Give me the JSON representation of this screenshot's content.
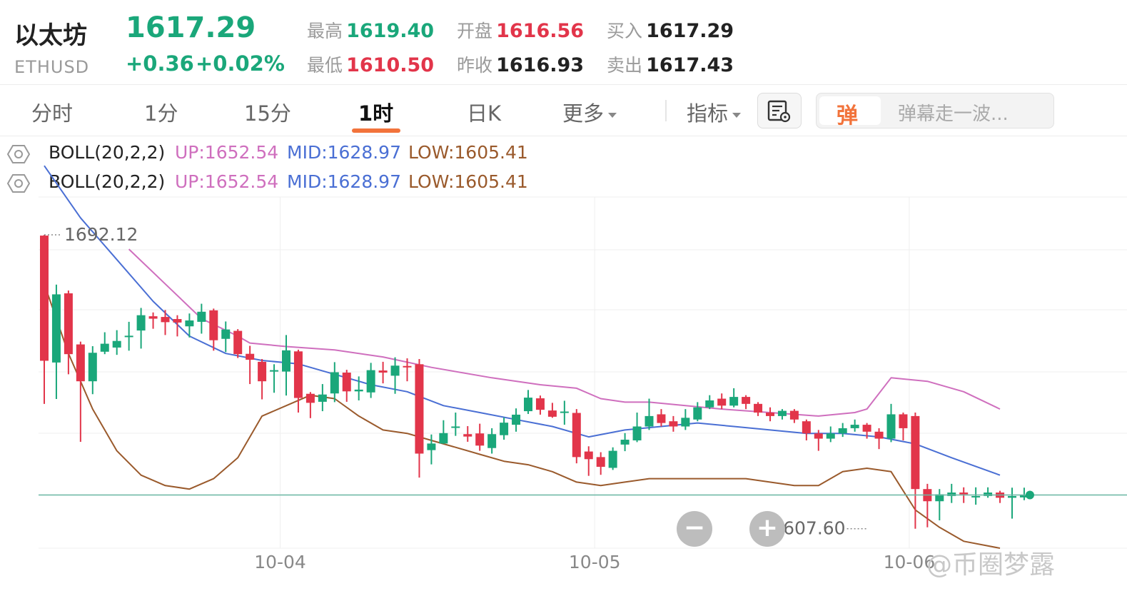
{
  "header": {
    "coin_name": "以太坊",
    "coin_code": "ETHUSD",
    "price": "1617.29",
    "change_abs": "+0.36",
    "change_pct": "+0.02%",
    "stats": [
      {
        "label": "最高",
        "value": "1619.40",
        "color": "green"
      },
      {
        "label": "最低",
        "value": "1610.50",
        "color": "red"
      },
      {
        "label": "开盘",
        "value": "1616.56",
        "color": "red"
      },
      {
        "label": "昨收",
        "value": "1616.93",
        "color": "dark"
      },
      {
        "label": "买入",
        "value": "1617.29",
        "color": "dark"
      },
      {
        "label": "卖出",
        "value": "1617.43",
        "color": "dark"
      }
    ]
  },
  "tabs": [
    {
      "label": "分时"
    },
    {
      "label": "1分"
    },
    {
      "label": "15分"
    },
    {
      "label": "1时",
      "active": true
    },
    {
      "label": "日K"
    },
    {
      "label": "更多"
    },
    {
      "label": "指标"
    }
  ],
  "danmu": {
    "icon_text": "弹",
    "placeholder": "弹幕走一波..."
  },
  "indicator_rows": [
    {
      "name": "BOLL(20,2,2)",
      "up": "UP:1652.54",
      "mid": "MID:1628.97",
      "low": "LOW:1605.41"
    },
    {
      "name": "BOLL(20,2,2)",
      "up": "UP:1652.54",
      "mid": "MID:1628.97",
      "low": "LOW:1605.41"
    }
  ],
  "zoom": {
    "minus": "−",
    "plus": "+"
  },
  "watermark": "@币圈梦露",
  "colors": {
    "up": "#1aa77a",
    "down": "#e2354a",
    "boll_up": "#cf6fbe",
    "boll_mid": "#4a6fd4",
    "boll_low": "#9a5a2c",
    "accent": "#f2733b",
    "last_price": "#6ab7a5"
  },
  "chart_data": {
    "type": "candlestick",
    "x_tick_labels": [
      {
        "label": "10-04",
        "index": 19.5
      },
      {
        "label": "10-05",
        "index": 45.5
      },
      {
        "label": "10-06",
        "index": 71.5
      }
    ],
    "ylim": [
      1602,
      1703
    ],
    "max_marker": {
      "value": "1692.12",
      "index": 0
    },
    "min_marker": {
      "value": "1607.60",
      "index": 68
    },
    "last_price": 1617.29,
    "candles": [
      [
        1691.9,
        1655.9,
        1692.1,
        1643.5
      ],
      [
        1655.4,
        1675.0,
        1677.8,
        1644.9
      ],
      [
        1675.3,
        1657.8,
        1676.1,
        1652.0
      ],
      [
        1660.6,
        1650.0,
        1661.4,
        1632.6
      ],
      [
        1650.0,
        1658.2,
        1660.1,
        1646.3
      ],
      [
        1658.5,
        1660.8,
        1664.1,
        1657.8
      ],
      [
        1659.7,
        1661.6,
        1664.7,
        1657.6
      ],
      [
        1662.9,
        1663.1,
        1667.1,
        1658.8
      ],
      [
        1664.6,
        1669.0,
        1671.1,
        1659.4
      ],
      [
        1668.7,
        1668.0,
        1669.8,
        1665.1
      ],
      [
        1668.5,
        1667.0,
        1670.5,
        1663.3
      ],
      [
        1667.9,
        1666.9,
        1669.0,
        1662.9
      ],
      [
        1665.8,
        1667.5,
        1669.5,
        1662.6
      ],
      [
        1667.1,
        1670.0,
        1672.3,
        1663.7
      ],
      [
        1670.4,
        1661.8,
        1670.9,
        1658.8
      ],
      [
        1662.2,
        1664.9,
        1667.2,
        1658.4
      ],
      [
        1664.5,
        1657.8,
        1665.0,
        1656.7
      ],
      [
        1657.9,
        1656.2,
        1660.2,
        1649.2
      ],
      [
        1655.6,
        1650.0,
        1656.4,
        1644.8
      ],
      [
        1652.8,
        1653.2,
        1654.9,
        1646.7
      ],
      [
        1652.8,
        1658.9,
        1663.3,
        1645.9
      ],
      [
        1658.6,
        1645.2,
        1659.1,
        1641.0
      ],
      [
        1646.4,
        1643.8,
        1646.9,
        1639.4
      ],
      [
        1644.1,
        1646.2,
        1649.2,
        1641.4
      ],
      [
        1646.5,
        1652.6,
        1655.5,
        1644.0
      ],
      [
        1652.5,
        1647.1,
        1653.3,
        1644.1
      ],
      [
        1647.1,
        1647.6,
        1651.4,
        1644.5
      ],
      [
        1646.8,
        1653.2,
        1655.3,
        1645.2
      ],
      [
        1653.1,
        1652.5,
        1655.6,
        1649.4
      ],
      [
        1651.6,
        1654.5,
        1656.9,
        1646.4
      ],
      [
        1654.4,
        1654.3,
        1656.6,
        1650.0
      ],
      [
        1654.9,
        1629.2,
        1656.4,
        1622.3
      ],
      [
        1630.2,
        1632.1,
        1634.7,
        1626.1
      ],
      [
        1632.1,
        1635.1,
        1638.8,
        1632.0
      ],
      [
        1637.0,
        1637.0,
        1641.0,
        1634.3
      ],
      [
        1634.8,
        1634.1,
        1637.1,
        1632.6
      ],
      [
        1635.0,
        1631.5,
        1637.8,
        1630.0
      ],
      [
        1630.8,
        1634.8,
        1636.5,
        1629.2
      ],
      [
        1634.5,
        1638.1,
        1639.6,
        1633.2
      ],
      [
        1637.5,
        1640.4,
        1642.2,
        1635.5
      ],
      [
        1641.4,
        1645.3,
        1647.5,
        1640.6
      ],
      [
        1645.1,
        1641.8,
        1645.9,
        1640.4
      ],
      [
        1641.6,
        1639.8,
        1643.8,
        1639.5
      ],
      [
        1640.9,
        1641.3,
        1644.4,
        1637.5
      ],
      [
        1640.9,
        1628.2,
        1642.0,
        1626.4
      ],
      [
        1629.8,
        1627.6,
        1631.3,
        1622.8
      ],
      [
        1628.2,
        1625.4,
        1629.6,
        1623.1
      ],
      [
        1625.1,
        1630.0,
        1631.0,
        1624.5
      ],
      [
        1631.8,
        1633.2,
        1635.1,
        1629.9
      ],
      [
        1633.0,
        1637.0,
        1641.0,
        1632.5
      ],
      [
        1637.0,
        1640.0,
        1645.0,
        1636.0
      ],
      [
        1640.5,
        1638.0,
        1642.0,
        1637.0
      ],
      [
        1638.5,
        1637.0,
        1640.0,
        1635.5
      ],
      [
        1637.0,
        1639.5,
        1642.0,
        1636.0
      ],
      [
        1639.0,
        1642.5,
        1644.0,
        1638.5
      ],
      [
        1642.5,
        1644.5,
        1646.0,
        1642.0
      ],
      [
        1645.0,
        1643.0,
        1646.5,
        1642.0
      ],
      [
        1643.0,
        1645.5,
        1648.0,
        1642.5
      ],
      [
        1645.5,
        1643.5,
        1646.0,
        1642.0
      ],
      [
        1643.5,
        1641.0,
        1644.0,
        1640.0
      ],
      [
        1641.0,
        1640.0,
        1642.5,
        1638.5
      ],
      [
        1640.0,
        1641.5,
        1642.0,
        1639.0
      ],
      [
        1641.5,
        1639.0,
        1642.0,
        1638.0
      ],
      [
        1638.5,
        1635.0,
        1639.0,
        1633.0
      ],
      [
        1635.0,
        1633.5,
        1636.0,
        1630.0
      ],
      [
        1633.5,
        1635.0,
        1637.0,
        1632.5
      ],
      [
        1635.0,
        1636.5,
        1638.0,
        1634.0
      ],
      [
        1636.5,
        1637.5,
        1639.0,
        1635.5
      ],
      [
        1637.5,
        1635.5,
        1638.0,
        1633.5
      ],
      [
        1635.5,
        1633.5,
        1636.5,
        1630.5
      ],
      [
        1633.5,
        1640.5,
        1643.5,
        1632.5
      ],
      [
        1640.5,
        1636.5,
        1641.0,
        1633.0
      ],
      [
        1640.0,
        1619.0,
        1641.0,
        1607.6
      ],
      [
        1619.0,
        1615.5,
        1620.5,
        1608.0
      ],
      [
        1615.5,
        1617.5,
        1619.0,
        1610.0
      ],
      [
        1617.0,
        1618.0,
        1620.5,
        1615.0
      ],
      [
        1618.0,
        1617.5,
        1619.5,
        1615.0
      ],
      [
        1617.0,
        1617.0,
        1619.5,
        1614.5
      ],
      [
        1617.0,
        1618.0,
        1619.5,
        1616.5
      ],
      [
        1618.0,
        1616.5,
        1618.5,
        1615.0
      ],
      [
        1616.5,
        1617.0,
        1619.4,
        1610.5
      ],
      [
        1616.6,
        1617.3,
        1619.4,
        1615.8
      ]
    ],
    "boll_up": [
      [
        7,
        1688
      ],
      [
        10,
        1678
      ],
      [
        13,
        1668
      ],
      [
        16,
        1663
      ],
      [
        17,
        1661
      ],
      [
        20,
        1660
      ],
      [
        24,
        1659
      ],
      [
        28,
        1657
      ],
      [
        32,
        1654
      ],
      [
        37,
        1651
      ],
      [
        41,
        1649
      ],
      [
        44,
        1648
      ],
      [
        46,
        1645
      ],
      [
        48,
        1644
      ],
      [
        50,
        1644
      ],
      [
        53,
        1643
      ],
      [
        56,
        1642
      ],
      [
        60,
        1641
      ],
      [
        64,
        1640
      ],
      [
        67,
        1641
      ],
      [
        68,
        1642
      ],
      [
        70,
        1651
      ],
      [
        73,
        1650
      ],
      [
        76,
        1647
      ],
      [
        79,
        1642
      ]
    ],
    "boll_mid": [
      [
        0,
        1712
      ],
      [
        3,
        1697
      ],
      [
        6,
        1685
      ],
      [
        9,
        1673
      ],
      [
        12,
        1663
      ],
      [
        15,
        1658
      ],
      [
        18,
        1656
      ],
      [
        21,
        1655
      ],
      [
        24,
        1652
      ],
      [
        27,
        1649
      ],
      [
        30,
        1647
      ],
      [
        33,
        1643
      ],
      [
        36,
        1641
      ],
      [
        39,
        1639
      ],
      [
        42,
        1637
      ],
      [
        45,
        1634
      ],
      [
        48,
        1636
      ],
      [
        51,
        1637
      ],
      [
        54,
        1638
      ],
      [
        57,
        1637
      ],
      [
        60,
        1636
      ],
      [
        63,
        1635
      ],
      [
        66,
        1635
      ],
      [
        69,
        1634
      ],
      [
        72,
        1632
      ],
      [
        75,
        1628
      ],
      [
        79,
        1623
      ]
    ],
    "boll_low": [
      [
        0,
        1678
      ],
      [
        2,
        1658
      ],
      [
        4,
        1642
      ],
      [
        6,
        1630
      ],
      [
        8,
        1623
      ],
      [
        10,
        1620
      ],
      [
        12,
        1619
      ],
      [
        14,
        1622
      ],
      [
        16,
        1628
      ],
      [
        18,
        1640
      ],
      [
        20,
        1643
      ],
      [
        22,
        1646
      ],
      [
        24,
        1645
      ],
      [
        26,
        1640
      ],
      [
        28,
        1636
      ],
      [
        30,
        1635
      ],
      [
        32,
        1633
      ],
      [
        34,
        1631
      ],
      [
        36,
        1629
      ],
      [
        38,
        1627
      ],
      [
        40,
        1626
      ],
      [
        42,
        1624
      ],
      [
        44,
        1621
      ],
      [
        46,
        1620
      ],
      [
        48,
        1621
      ],
      [
        50,
        1622
      ],
      [
        54,
        1622
      ],
      [
        58,
        1622
      ],
      [
        62,
        1620
      ],
      [
        64,
        1620
      ],
      [
        66,
        1624
      ],
      [
        68,
        1625
      ],
      [
        70,
        1624
      ],
      [
        72,
        1613
      ],
      [
        74,
        1608
      ],
      [
        76,
        1604
      ],
      [
        79,
        1602
      ]
    ]
  }
}
